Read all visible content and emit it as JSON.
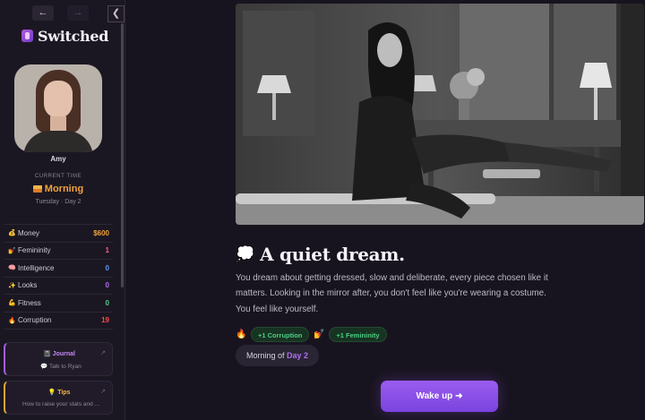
{
  "nav": {
    "back_label": "←",
    "forward_label": "→",
    "collapse_label": "❮"
  },
  "brand": {
    "title": "Switched",
    "accent": "#b25be0"
  },
  "character": {
    "name": "Amy"
  },
  "time": {
    "label": "CURRENT TIME",
    "value": "Morning",
    "sub": "Tuesday · Day 2",
    "color": "#f0a23c"
  },
  "stats": [
    {
      "icon": "💰",
      "label": "Money",
      "value": "$600",
      "color": "#f0a23c"
    },
    {
      "icon": "💅",
      "label": "Femininity",
      "value": "1",
      "color": "#ff5c8a"
    },
    {
      "icon": "🧠",
      "label": "Intelligence",
      "value": "0",
      "color": "#5a9cf5"
    },
    {
      "icon": "✨",
      "label": "Looks",
      "value": "0",
      "color": "#b06df2"
    },
    {
      "icon": "💪",
      "label": "Fitness",
      "value": "0",
      "color": "#4dcf84"
    },
    {
      "icon": "🔥",
      "label": "Corruption",
      "value": "19",
      "color": "#ff4d4d"
    }
  ],
  "journal": {
    "title": "📓 Journal",
    "sub": "💬 Talk to Ryan",
    "arrow": "↗"
  },
  "tips": {
    "title": "💡 Tips",
    "sub": "How to raise your stats and ...",
    "arrow": "↗"
  },
  "dream": {
    "icon": "💭",
    "title": "A quiet dream.",
    "text": "You dream about getting dressed, slow and deliberate, every piece chosen like it matters. Looking in the mirror after, you don't feel like you're wearing a costume. You feel like yourself."
  },
  "effects": [
    {
      "icon": "🔥",
      "label": "+1 Corruption"
    },
    {
      "icon": "💅",
      "label": "+1 Femininity"
    }
  ],
  "period": {
    "prefix": "Morning of",
    "day": "Day 2"
  },
  "action": {
    "label": "Wake up ➜",
    "color": "#8b50e8"
  }
}
